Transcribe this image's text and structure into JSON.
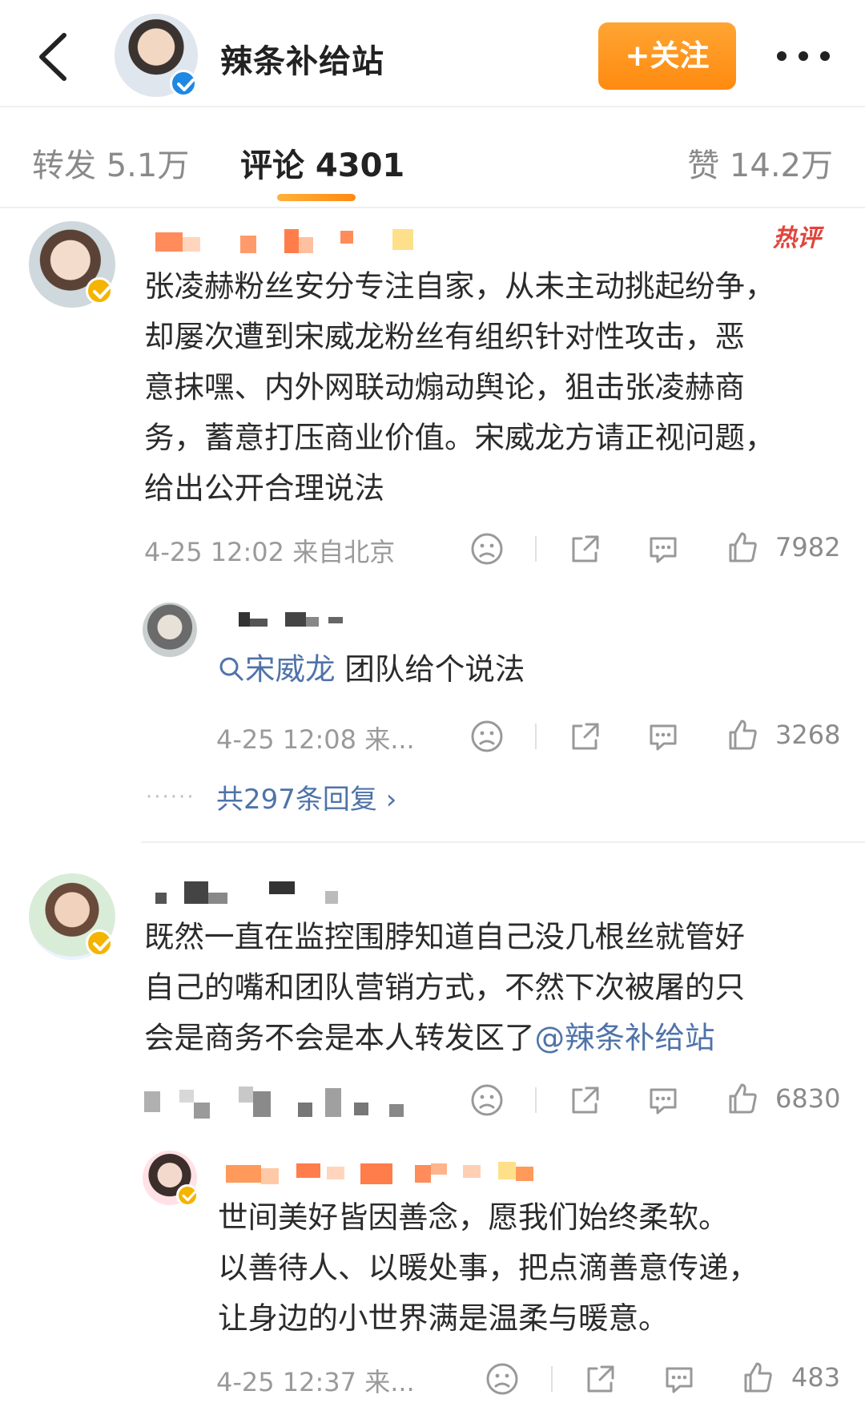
{
  "header": {
    "title": "辣条补给站",
    "follow_label": "+关注"
  },
  "tabs": {
    "repost": "转发 5.1万",
    "comments": "评论 4301",
    "likes": "赞 14.2万"
  },
  "comments": [
    {
      "hot_label": "热评",
      "text": "张凌赫粉丝安分专注自家，从未主动挑起纷争，却屡次遭到宋威龙粉丝有组织针对性攻击，恶意抹嘿、内外网联动煽动舆论，狙击张凌赫商务，蓄意打压商业价值。宋威龙方请正视问题，给出公开合理说法",
      "lines": [
        "张凌赫粉丝安分专注自家，从未主动挑起纷争，",
        "却屡次遭到宋威龙粉丝有组织针对性攻击，恶",
        "意抹嘿、内外网联动煽动舆论，狙击张凌赫商",
        "务，蓄意打压商业价值。宋威龙方请正视问题，",
        "给出公开合理说法"
      ],
      "meta": "4-25 12:02 来自北京",
      "likes": "7982",
      "reply": {
        "link": "宋威龙",
        "text": " 团队给个说法",
        "meta": "4-25 12:08 来...",
        "likes": "3268"
      },
      "more_replies": "共297条回复 ›",
      "dots": "······"
    },
    {
      "lines": [
        "既然一直在监控围脖知道自己没几根丝就管好",
        "自己的嘴和团队营销方式，不然下次被屠的只"
      ],
      "line3_text": "会是商务不会是本人转发区了",
      "line3_link": "@辣条补给站",
      "likes": "6830",
      "reply": {
        "lines": [
          "世间美好皆因善念，愿我们始终柔软。",
          "以善待人、以暖处事，把点滴善意传递，",
          "让身边的小世界满是温柔与暖意。"
        ],
        "meta": "4-25 12:37 来...",
        "likes": "483"
      }
    }
  ],
  "colors": {
    "accent_orange": "#ff8a10",
    "link_blue": "#4f73a9",
    "hot_red": "#e0453d",
    "verified_blue": "#1e88e5",
    "verified_gold": "#f5b400"
  }
}
